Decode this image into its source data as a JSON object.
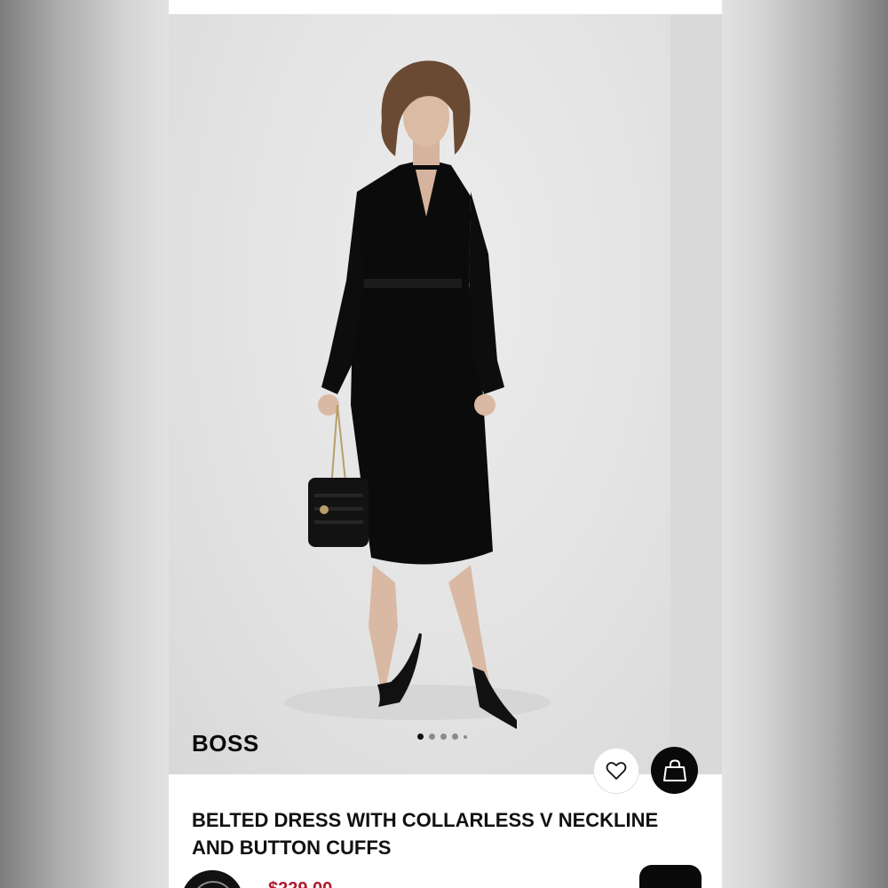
{
  "product": {
    "brand": "BOSS",
    "title": "BELTED DRESS WITH COLLARLESS V NECKLINE AND BUTTON CUFFS",
    "price": "$229.00"
  },
  "carousel": {
    "dots": 5,
    "active_index": 0
  },
  "actions": {
    "favorite_icon": "heart-icon",
    "bag_icon": "shopping-bag-icon"
  },
  "colors": {
    "accent": "#0a0a0a",
    "price": "#b01c2e"
  }
}
